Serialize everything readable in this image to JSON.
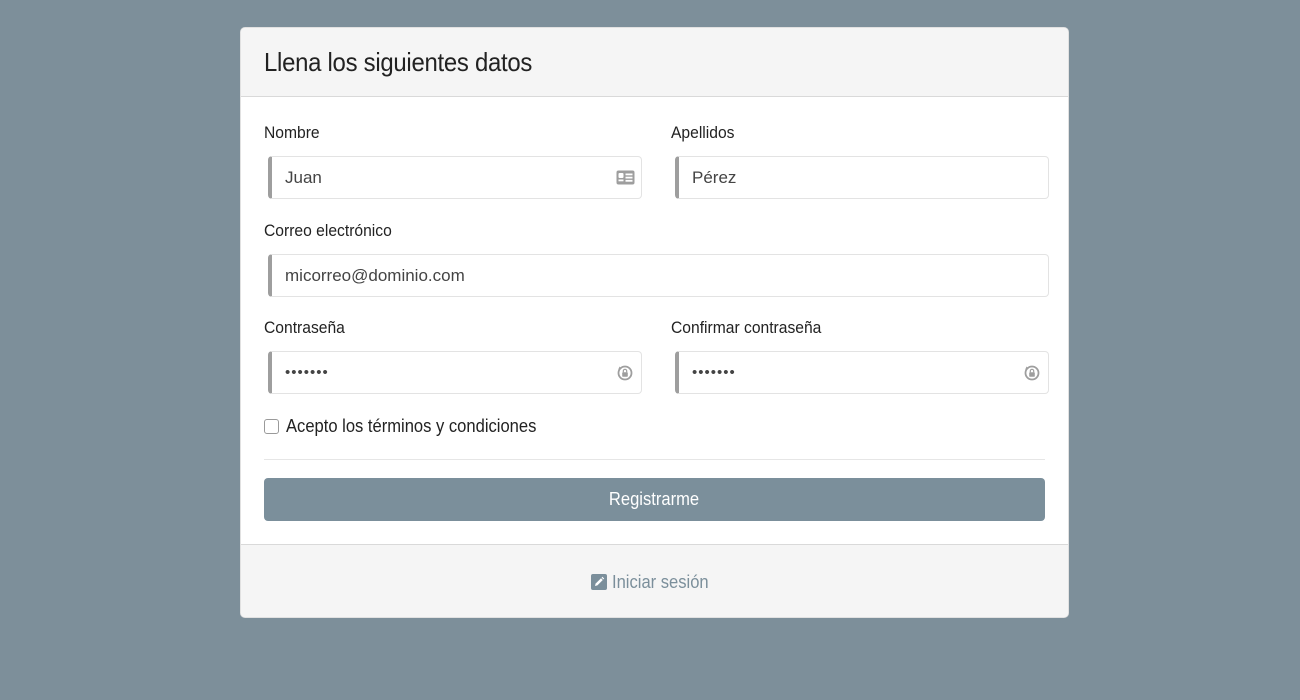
{
  "form": {
    "title": "Llena los siguientes datos",
    "fields": {
      "nombre": {
        "label": "Nombre",
        "value": "Juan",
        "icon": "id-card-icon"
      },
      "apellidos": {
        "label": "Apellidos",
        "value": "Pérez"
      },
      "correo": {
        "label": "Correo electrónico",
        "value": "micorreo@dominio.com"
      },
      "contrasena": {
        "label": "Contraseña",
        "value": "1234567",
        "icon": "password-key-icon"
      },
      "confirmar": {
        "label": "Confirmar contraseña",
        "value": "1234567",
        "icon": "password-key-icon"
      }
    },
    "terms": {
      "label": "Acepto los términos y condiciones",
      "checked": false
    },
    "submit_label": "Registrarme"
  },
  "footer": {
    "login_label": "Iniciar sesión",
    "login_icon": "edit-icon"
  },
  "colors": {
    "background": "#7d8f9a",
    "accent": "#7b8f9b",
    "header_bg": "#f5f5f5",
    "input_left_border": "#9e9e9e"
  }
}
